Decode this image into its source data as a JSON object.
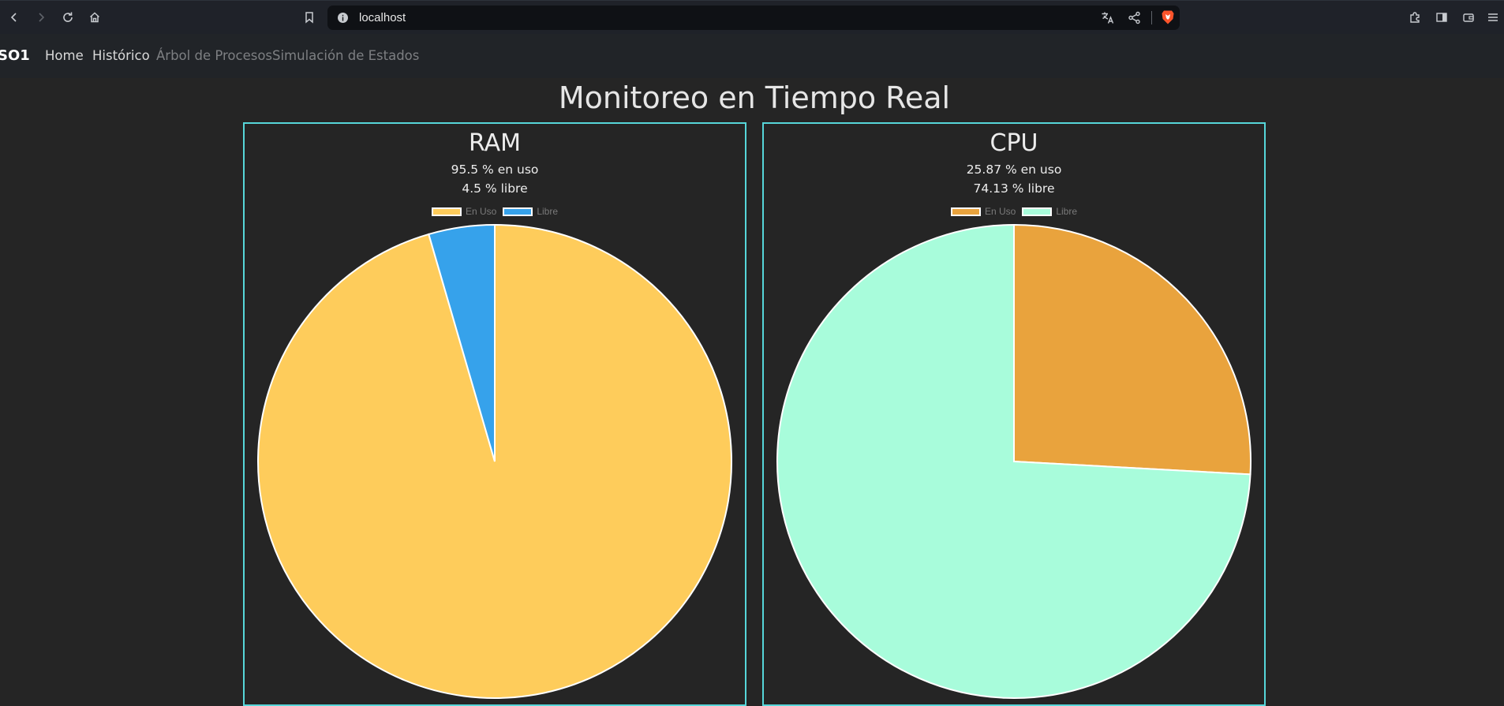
{
  "browser": {
    "url": "localhost",
    "icons": [
      "back-icon",
      "forward-icon",
      "reload-icon",
      "home-icon",
      "bookmark-icon",
      "site-info-icon",
      "translate-icon",
      "share-icon",
      "brave-shield-icon",
      "extensions-icon",
      "sidebar-icon",
      "wallet-icon",
      "menu-icon"
    ]
  },
  "navbar": {
    "brand": "SO1",
    "links": [
      "Home",
      "Histórico",
      "Árbol de Procesos",
      "Simulación de Estados"
    ]
  },
  "page": {
    "title": "Monitoreo en Tiempo Real"
  },
  "legend_labels": [
    "En Uso",
    "Libre"
  ],
  "chart_data": [
    {
      "type": "pie",
      "title": "RAM",
      "used_text": "95.5 % en uso",
      "free_text": "4.5 % libre",
      "categories": [
        "En Uso",
        "Libre"
      ],
      "values": [
        95.5,
        4.5
      ],
      "colors": [
        "#fecc5b",
        "#36a2eb"
      ]
    },
    {
      "type": "pie",
      "title": "CPU",
      "used_text": "25.87 % en uso",
      "free_text": "74.13 % libre",
      "categories": [
        "En Uso",
        "Libre"
      ],
      "values": [
        25.87,
        74.13
      ],
      "colors": [
        "#e9a33d",
        "#a8fcdb"
      ]
    }
  ]
}
